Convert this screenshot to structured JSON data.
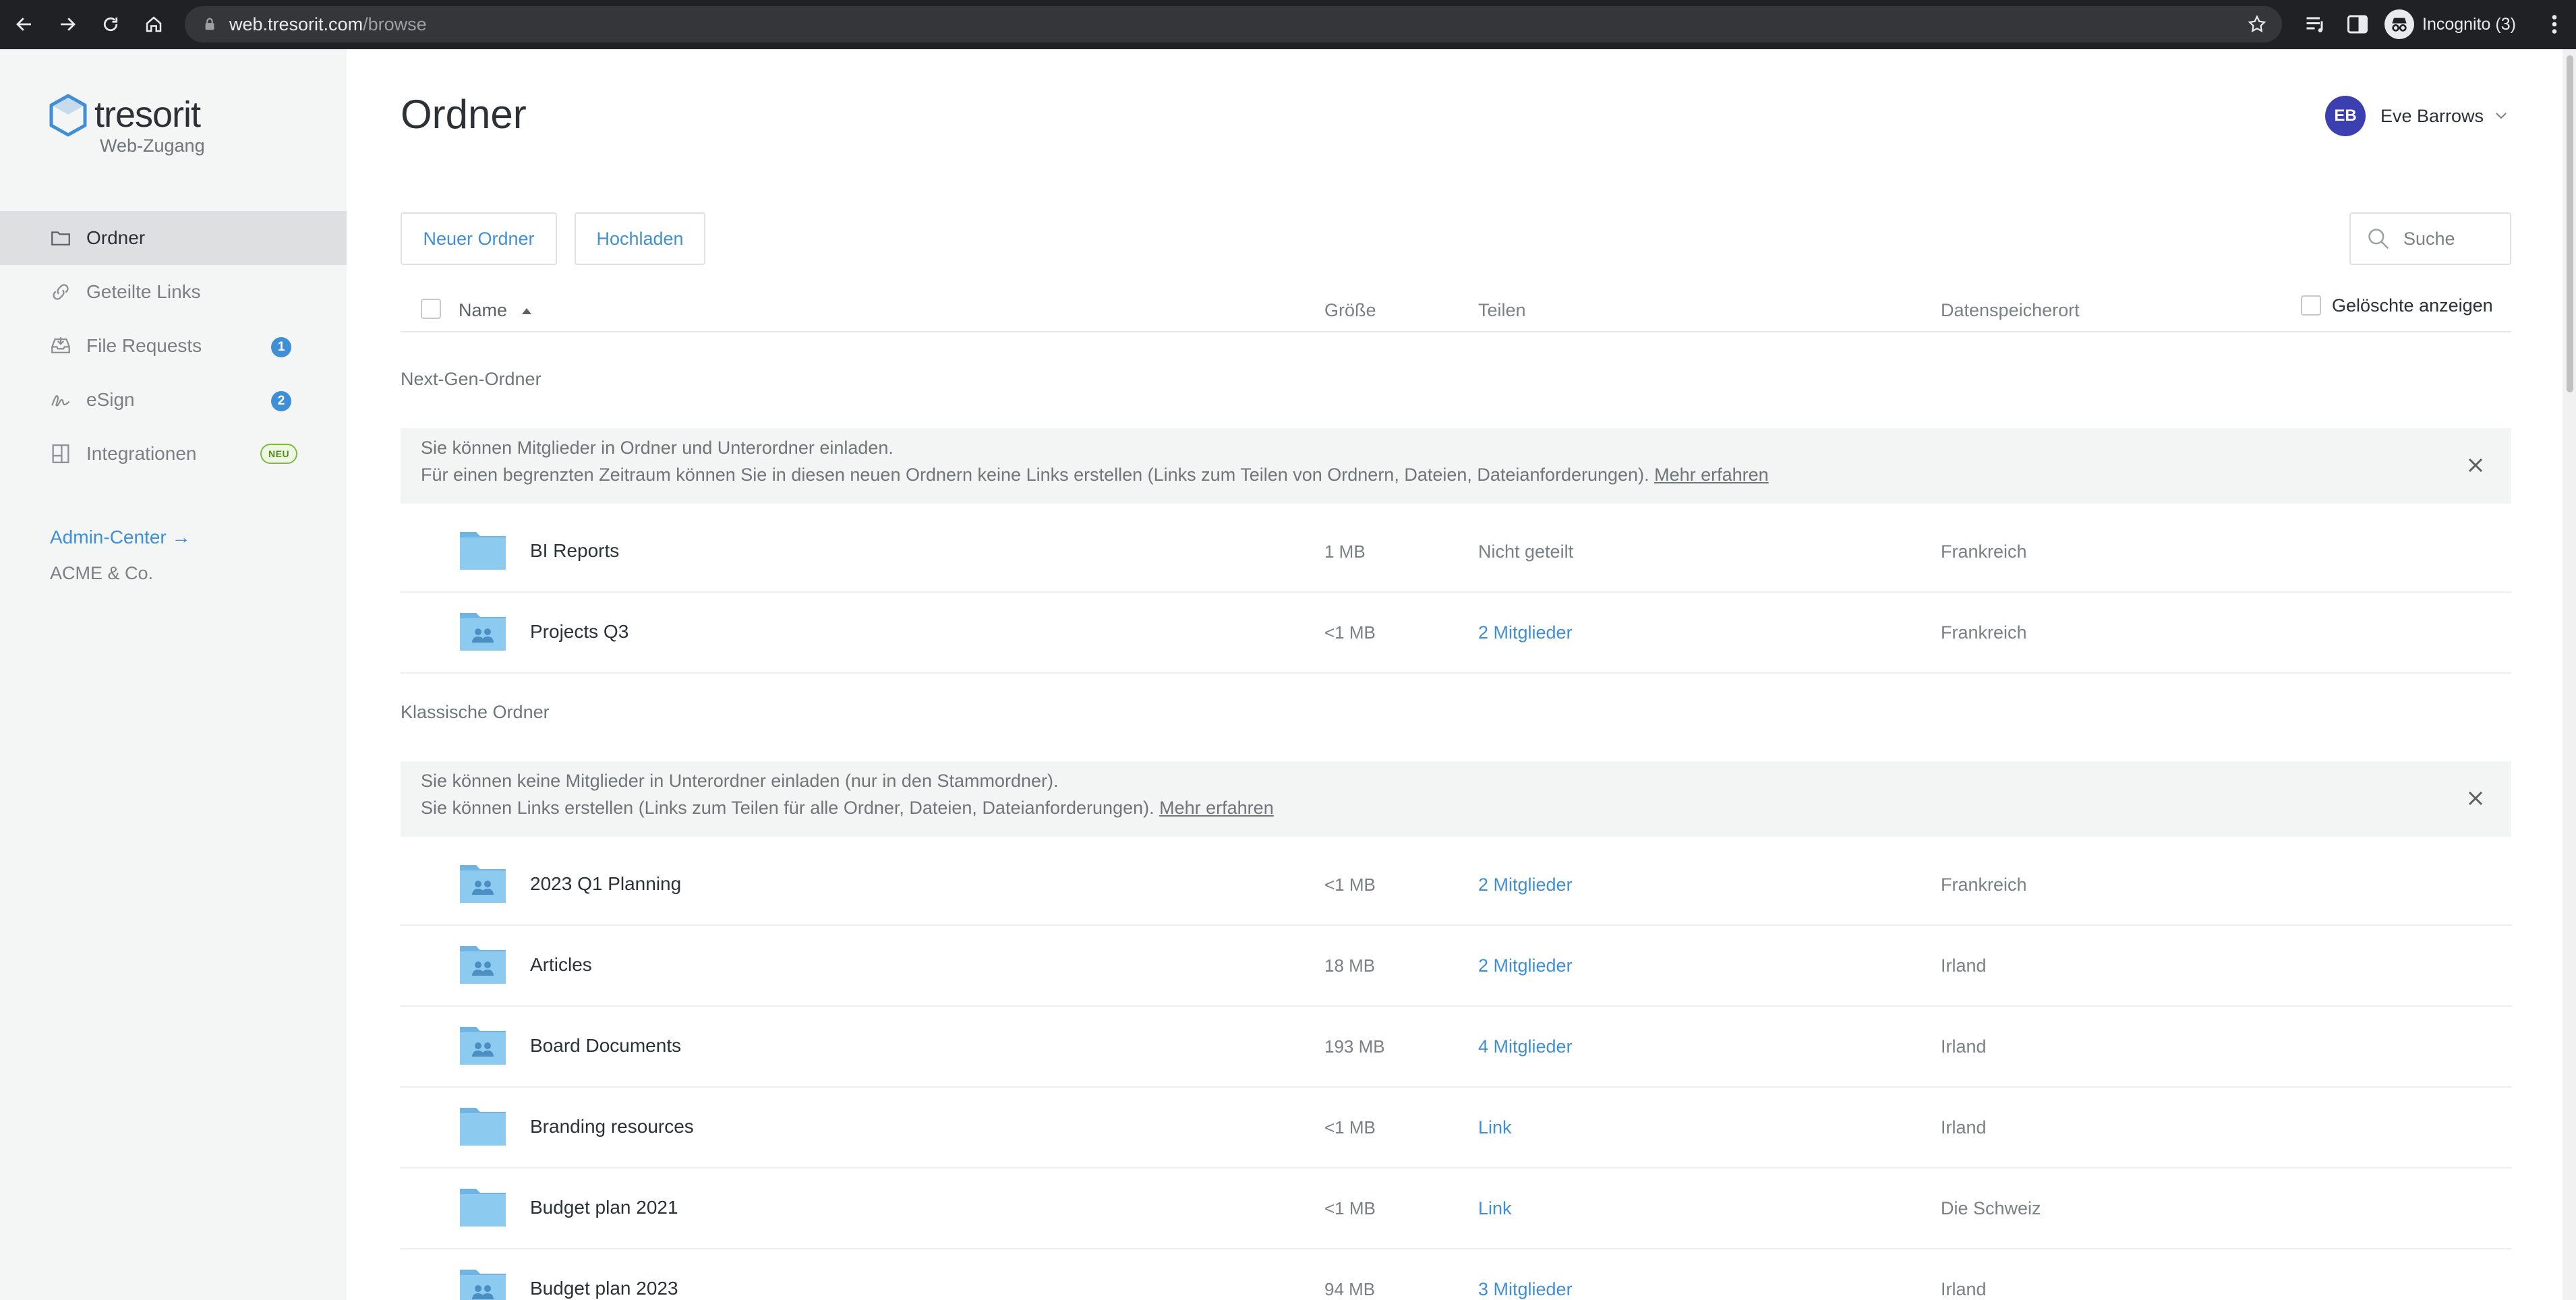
{
  "browser": {
    "url_host": "web.tresorit.com",
    "url_path": "/browse",
    "profile_label": "Incognito (3)"
  },
  "sidebar": {
    "brand": "tresorit",
    "subtitle": "Web-Zugang",
    "items": [
      {
        "label": "Ordner",
        "icon": "folder-icon",
        "active": true
      },
      {
        "label": "Geteilte Links",
        "icon": "link-icon"
      },
      {
        "label": "File Requests",
        "icon": "inbox-icon",
        "badge": "1"
      },
      {
        "label": "eSign",
        "icon": "signature-icon",
        "badge": "2"
      },
      {
        "label": "Integrationen",
        "icon": "integrations-icon",
        "tag": "NEU"
      }
    ],
    "admin_link": "Admin-Center →",
    "company": "ACME & Co."
  },
  "header": {
    "title": "Ordner",
    "user_initials": "EB",
    "user_name": "Eve Barrows"
  },
  "toolbar": {
    "new_folder": "Neuer Ordner",
    "upload": "Hochladen",
    "search_placeholder": "Suche"
  },
  "table": {
    "col_name": "Name",
    "col_size": "Größe",
    "col_share": "Teilen",
    "col_location": "Datenspeicherort",
    "show_deleted": "Gelöschte anzeigen"
  },
  "sections": [
    {
      "label": "Next-Gen-Ordner",
      "info_line1": "Sie können Mitglieder in Ordner und Unterordner einladen.",
      "info_line2": "Für einen begrenzten Zeitraum können Sie in diesen neuen Ordnern keine Links erstellen (Links zum Teilen von Ordnern, Dateien, Dateianforderungen).",
      "info_more": "Mehr erfahren",
      "rows": [
        {
          "name": "BI Reports",
          "size": "1 MB",
          "share": "Nicht geteilt",
          "location": "Frankreich",
          "shared": false
        },
        {
          "name": "Projects Q3",
          "size": "<1 MB",
          "share": "2 Mitglieder",
          "location": "Frankreich",
          "shared": true
        }
      ]
    },
    {
      "label": "Klassische Ordner",
      "info_line1": "Sie können keine Mitglieder in Unterordner einladen (nur in den Stammordner).",
      "info_line2": "Sie können Links erstellen (Links zum Teilen für alle Ordner, Dateien, Dateianforderungen).",
      "info_more": "Mehr erfahren",
      "rows": [
        {
          "name": "2023 Q1 Planning",
          "size": "<1 MB",
          "share": "2 Mitglieder",
          "location": "Frankreich",
          "shared": true
        },
        {
          "name": "Articles",
          "size": "18 MB",
          "share": "2 Mitglieder",
          "location": "Irland",
          "shared": true
        },
        {
          "name": "Board Documents",
          "size": "193 MB",
          "share": "4 Mitglieder",
          "location": "Irland",
          "shared": true
        },
        {
          "name": "Branding resources",
          "size": "<1 MB",
          "share": "Link",
          "location": "Irland",
          "shared": false
        },
        {
          "name": "Budget plan 2021",
          "size": "<1 MB",
          "share": "Link",
          "location": "Die Schweiz",
          "shared": false
        },
        {
          "name": "Budget plan 2023",
          "size": "94 MB",
          "share": "3 Mitglieder",
          "location": "Irland",
          "shared": true
        }
      ]
    }
  ],
  "colors": {
    "accent": "#3f8fd8",
    "folder": "#8ccbef",
    "folder_dark": "#6fb5e4",
    "avatar": "#3b3fb0",
    "sidebar_bg": "#f4f5f5",
    "active_bg": "#dedfe0"
  }
}
